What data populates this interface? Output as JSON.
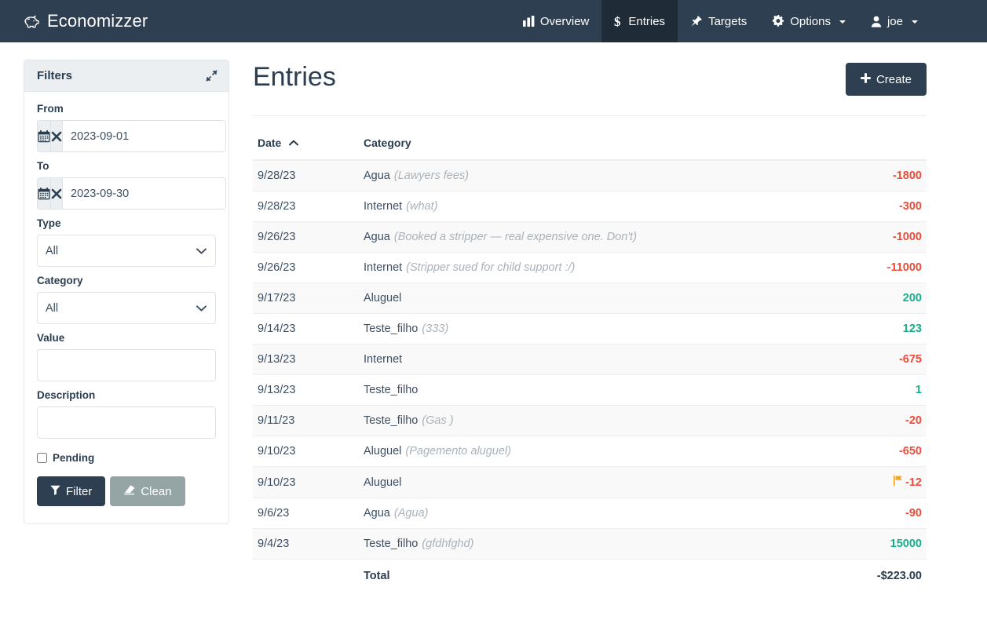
{
  "brand": {
    "name": "Economizzer",
    "icon": "piggy-bank-icon"
  },
  "nav": {
    "items": [
      {
        "label": "Overview",
        "icon": "bar-chart-icon",
        "active": false,
        "caret": false
      },
      {
        "label": "Entries",
        "icon": "dollar-icon",
        "active": true,
        "caret": false
      },
      {
        "label": "Targets",
        "icon": "thumbtack-icon",
        "active": false,
        "caret": false
      },
      {
        "label": "Options",
        "icon": "gear-icon",
        "active": false,
        "caret": true
      },
      {
        "label": "joe",
        "icon": "user-icon",
        "active": false,
        "caret": true
      }
    ]
  },
  "filters": {
    "title": "Filters",
    "collapse_icon": "compress-arrows-icon",
    "from": {
      "label": "From",
      "value": "2023-09-01",
      "calendar_icon": "calendar-icon",
      "clear_icon": "times-icon"
    },
    "to": {
      "label": "To",
      "value": "2023-09-30",
      "calendar_icon": "calendar-icon",
      "clear_icon": "times-icon"
    },
    "type": {
      "label": "Type",
      "value": "All",
      "options": [
        "All"
      ]
    },
    "category": {
      "label": "Category",
      "value": "All",
      "options": [
        "All"
      ]
    },
    "value": {
      "label": "Value",
      "value": "",
      "placeholder": ""
    },
    "description": {
      "label": "Description",
      "value": "",
      "placeholder": ""
    },
    "pending": {
      "label": "Pending",
      "checked": false
    },
    "filter_button": {
      "label": "Filter",
      "icon": "funnel-icon"
    },
    "clean_button": {
      "label": "Clean",
      "icon": "eraser-icon"
    }
  },
  "main": {
    "title": "Entries",
    "create_button": {
      "label": "Create",
      "icon": "plus-icon"
    },
    "table": {
      "columns": [
        {
          "label": "Date",
          "sort": "asc",
          "sort_icon": "caret-up-icon"
        },
        {
          "label": "Category",
          "sort": ""
        },
        {
          "label": "",
          "sort": ""
        }
      ],
      "rows": [
        {
          "date": "9/28/23",
          "category": "Agua",
          "description": "(Lawyers fees)",
          "value": "-1800",
          "sign": "neg",
          "flag": false
        },
        {
          "date": "9/28/23",
          "category": "Internet",
          "description": "(what)",
          "value": "-300",
          "sign": "neg",
          "flag": false
        },
        {
          "date": "9/26/23",
          "category": "Agua",
          "description": "(Booked a stripper — real expensive one. Don't)",
          "value": "-1000",
          "sign": "neg",
          "flag": false
        },
        {
          "date": "9/26/23",
          "category": "Internet",
          "description": "(Stripper sued for child support :/)",
          "value": "-11000",
          "sign": "neg",
          "flag": false
        },
        {
          "date": "9/17/23",
          "category": "Aluguel",
          "description": "",
          "value": "200",
          "sign": "pos",
          "flag": false
        },
        {
          "date": "9/14/23",
          "category": "Teste_filho",
          "description": "(333)",
          "value": "123",
          "sign": "pos",
          "flag": false
        },
        {
          "date": "9/13/23",
          "category": "Internet",
          "description": "",
          "value": "-675",
          "sign": "neg",
          "flag": false
        },
        {
          "date": "9/13/23",
          "category": "Teste_filho",
          "description": "",
          "value": "1",
          "sign": "pos",
          "flag": false
        },
        {
          "date": "9/11/23",
          "category": "Teste_filho",
          "description": "(Gas )",
          "value": "-20",
          "sign": "neg",
          "flag": false
        },
        {
          "date": "9/10/23",
          "category": "Aluguel",
          "description": "(Pagemento aluguel)",
          "value": "-650",
          "sign": "neg",
          "flag": false
        },
        {
          "date": "9/10/23",
          "category": "Aluguel",
          "description": "",
          "value": "-12",
          "sign": "neg",
          "flag": true
        },
        {
          "date": "9/6/23",
          "category": "Agua",
          "description": "(Agua)",
          "value": "-90",
          "sign": "neg",
          "flag": false
        },
        {
          "date": "9/4/23",
          "category": "Teste_filho",
          "description": "(gfdhfghd)",
          "value": "15000",
          "sign": "pos",
          "flag": false
        }
      ],
      "total": {
        "label": "Total",
        "value": "-$223.00"
      }
    }
  },
  "colors": {
    "navbar": "#2e3f52",
    "navbar_active": "#1f2c38",
    "negative": "#ee4b39",
    "positive": "#14b08a",
    "flag": "#f5a623",
    "panel_head": "#eceff1",
    "muted_button": "#95a5a6"
  }
}
